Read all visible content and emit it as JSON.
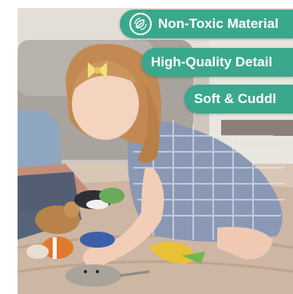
{
  "badges": [
    {
      "label": "Non-Toxic Material",
      "icon": "leaf-recycle-icon"
    },
    {
      "label": "High-Quality Detail",
      "icon": ""
    },
    {
      "label": "Soft & Cuddl",
      "icon": ""
    }
  ],
  "colors": {
    "badge": "#3aa88c",
    "badge_light": "#4dbb9f"
  }
}
